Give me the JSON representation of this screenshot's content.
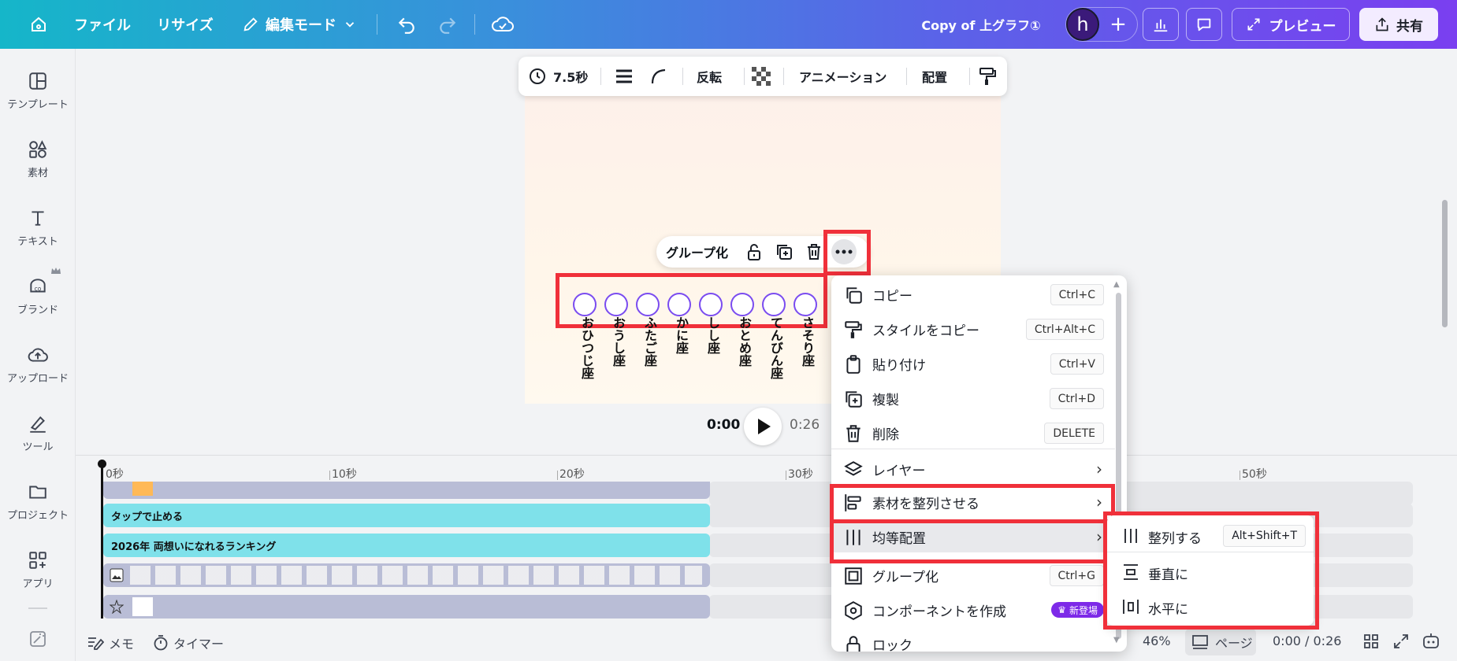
{
  "topbar": {
    "file": "ファイル",
    "resize": "リサイズ",
    "edit_mode": "編集モード",
    "doc_title": "Copy of 上グラフ①",
    "avatar_letter": "h",
    "preview": "プレビュー",
    "share": "共有"
  },
  "sidebar": {
    "items": [
      {
        "label": "テンプレート",
        "icon": "template-icon"
      },
      {
        "label": "素材",
        "icon": "elements-icon"
      },
      {
        "label": "テキスト",
        "icon": "text-icon"
      },
      {
        "label": "ブランド",
        "icon": "brand-icon"
      },
      {
        "label": "アップロード",
        "icon": "upload-icon"
      },
      {
        "label": "ツール",
        "icon": "tools-icon"
      },
      {
        "label": "プロジェクト",
        "icon": "projects-icon"
      },
      {
        "label": "アプリ",
        "icon": "apps-icon"
      }
    ]
  },
  "context_toolbar": {
    "duration": "7.5秒",
    "flip": "反転",
    "animation": "アニメーション",
    "position": "配置"
  },
  "float_bar": {
    "group": "グループ化"
  },
  "signs": [
    "おひつじ座",
    "おうし座",
    "ふたご座",
    "かに座",
    "しし座",
    "おとめ座",
    "てんびん座",
    "さそり座"
  ],
  "playback": {
    "current": "0:00",
    "total": "0:26"
  },
  "timeline": {
    "ruler": [
      "0秒",
      "10秒",
      "20秒",
      "30秒",
      "50秒"
    ],
    "tracks": [
      {
        "label": ""
      },
      {
        "label": "タップで止める"
      },
      {
        "label": "2026年 両想いになれるランキング"
      },
      {
        "label": ""
      },
      {
        "label": ""
      }
    ]
  },
  "bottombar": {
    "notes": "メモ",
    "timer": "タイマー",
    "zoom": "46%",
    "pages": "ページ",
    "time": "0:00 / 0:26"
  },
  "menu": {
    "items": [
      {
        "label": "コピー",
        "shortcut": "Ctrl+C",
        "icon": "copy-icon"
      },
      {
        "label": "スタイルをコピー",
        "shortcut": "Ctrl+Alt+C",
        "icon": "paint-roller-icon"
      },
      {
        "label": "貼り付け",
        "shortcut": "Ctrl+V",
        "icon": "clipboard-icon"
      },
      {
        "label": "複製",
        "shortcut": "Ctrl+D",
        "icon": "duplicate-icon"
      },
      {
        "label": "削除",
        "shortcut": "DELETE",
        "icon": "trash-icon"
      },
      {
        "label": "レイヤー",
        "icon": "layers-icon"
      },
      {
        "label": "素材を整列させる",
        "icon": "align-icon"
      },
      {
        "label": "均等配置",
        "icon": "distribute-icon"
      },
      {
        "label": "グループ化",
        "shortcut": "Ctrl+G",
        "icon": "group-icon"
      },
      {
        "label": "コンポーネントを作成",
        "badge": "新登場",
        "icon": "component-icon"
      },
      {
        "label": "ロック",
        "icon": "lock-icon"
      }
    ]
  },
  "submenu": {
    "items": [
      {
        "label": "整列する",
        "shortcut": "Alt+Shift+T",
        "icon": "tidy-up-icon"
      },
      {
        "label": "垂直に",
        "icon": "vertical-distribute-icon"
      },
      {
        "label": "水平に",
        "icon": "horizontal-distribute-icon"
      }
    ]
  },
  "colors": {
    "accent": "#7d2ae8",
    "highlight_red": "#f0303a",
    "track_cyan": "#7fe1ea",
    "track_gray": "#b9bdd6"
  }
}
